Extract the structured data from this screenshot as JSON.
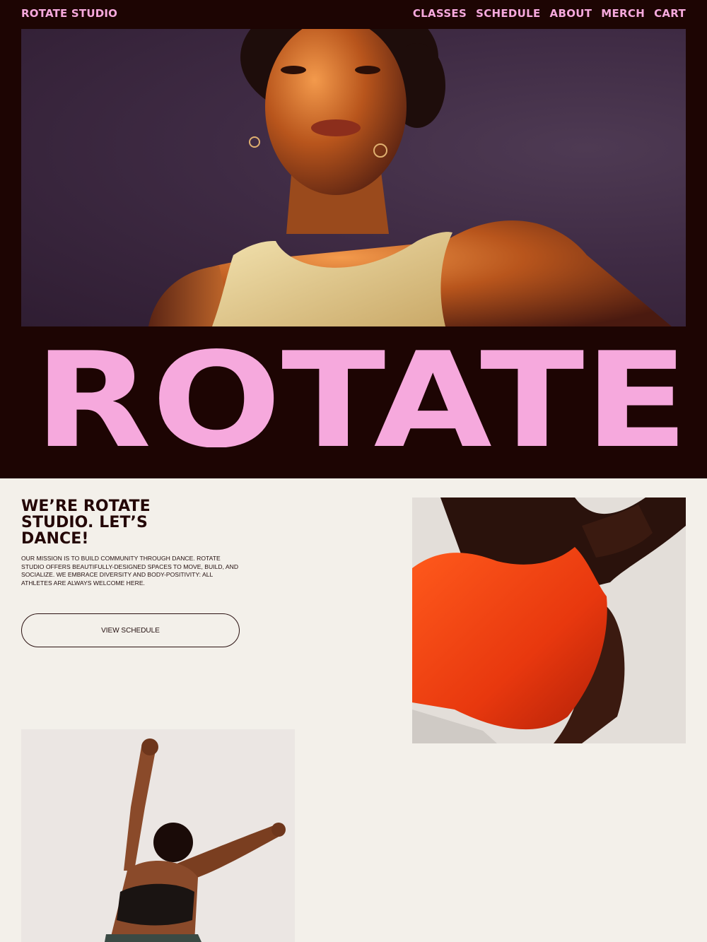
{
  "header": {
    "brand": "ROTATE STUDIO",
    "nav": [
      "CLASSES",
      "SCHEDULE",
      "ABOUT",
      "MERCH",
      "CART"
    ]
  },
  "hero": {
    "image_alt": "Portrait of a dancer in a white tank top lit in warm orange against a purple backdrop",
    "wordmark": "ROTATE"
  },
  "about": {
    "headline_lines": [
      "WE’RE ROTATE",
      "STUDIO. LET’S",
      "DANCE!"
    ],
    "mission": "OUR MISSION IS TO BUILD COMMUNITY THROUGH DANCE. ROTATE STUDIO OFFERS BEAUTIFULLY-DESIGNED SPACES TO MOVE, BUILD, AND SOCIALIZE. WE EMBRACE DIVERSITY AND BODY-POSITIVITY: ALL ATHLETES ARE ALWAYS WELCOME HERE.",
    "cta_label": "VIEW SCHEDULE"
  },
  "gallery": {
    "image2_alt": "Dancer in an orange crop top leaning back",
    "image3_alt": "Dancer in a black sports bra with arms raised"
  },
  "colors": {
    "dark_bg": "#1d0503",
    "pink": "#f6a9dd",
    "cream": "#f3f0ea",
    "text": "#240707",
    "orange": "#ff4a14"
  }
}
